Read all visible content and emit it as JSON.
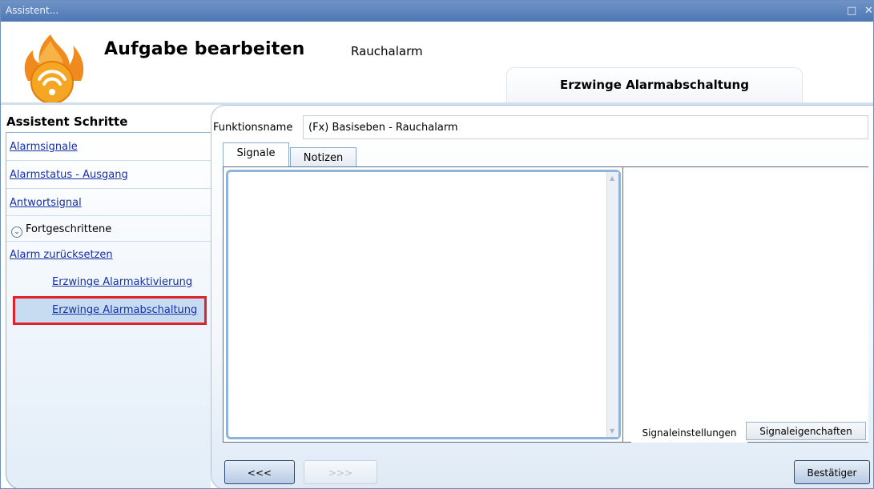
{
  "window": {
    "title": "Assistent..."
  },
  "header": {
    "title": "Aufgabe bearbeiten",
    "subtitle": "Rauchalarm",
    "current_step": "Erzwinge Alarmabschaltung"
  },
  "sidebar": {
    "title": "Assistent Schritte",
    "items": [
      {
        "label": "Alarmsignale"
      },
      {
        "label": "Alarmstatus - Ausgang"
      },
      {
        "label": "Antwortsignal"
      },
      {
        "label": "Fortgeschrittene"
      },
      {
        "label": "Alarm zurücksetzen"
      },
      {
        "label": "Erzwinge Alarmaktivierung"
      },
      {
        "label": "Erzwinge Alarmabschaltung"
      }
    ]
  },
  "main": {
    "function_name_label": "Funktionsname",
    "function_name_value": "(Fx) Basiseben - Rauchalarm",
    "tabs": [
      {
        "label": "Signale"
      },
      {
        "label": "Notizen"
      }
    ],
    "right_tabs": [
      {
        "label": "Signaleinstellungen"
      },
      {
        "label": "Signaleigenchaften"
      }
    ]
  },
  "footer": {
    "back_label": "<<<",
    "next_label": ">>>",
    "confirm_label": "Bestätiger"
  },
  "colors": {
    "titlebar": "#5a82bb",
    "selection_highlight": "#e0222c",
    "link": "#1530a8",
    "logo_orange": "#f08a1c"
  }
}
